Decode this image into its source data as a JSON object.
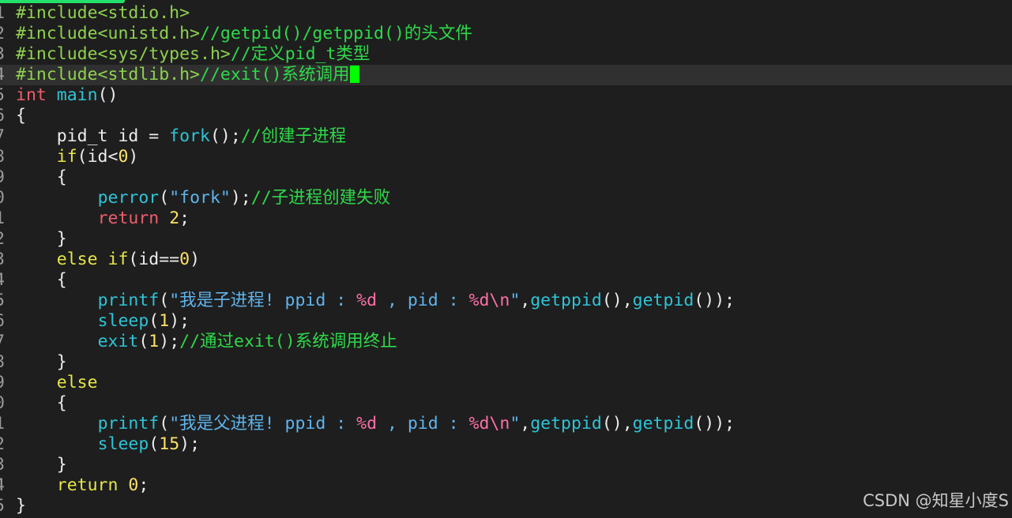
{
  "colors": {
    "preproc": "#8fd14f",
    "comment": "#2fd94a",
    "keyword": "#ee5d6c",
    "keyword2": "#e6e64a",
    "func": "#2ec4d6",
    "number": "#ffe066",
    "string": "#5fb4ec",
    "format": "#ff6fa8",
    "plain": "#ececec"
  },
  "watermark": "CSDN @知星小度S",
  "lines": [
    {
      "n": "1",
      "tokens": [
        {
          "t": "#include<stdio.h>",
          "c": "preproc"
        }
      ]
    },
    {
      "n": "2",
      "tokens": [
        {
          "t": "#include<unistd.h>",
          "c": "preproc"
        },
        {
          "t": "//getpid()/getppid()的头文件",
          "c": "comment"
        }
      ]
    },
    {
      "n": "3",
      "tokens": [
        {
          "t": "#include<sys/types.h>",
          "c": "preproc"
        },
        {
          "t": "//定义pid_t类型",
          "c": "comment"
        }
      ]
    },
    {
      "n": "4",
      "current": true,
      "cursor": true,
      "tokens": [
        {
          "t": "#include<stdlib.h>",
          "c": "preproc"
        },
        {
          "t": "//exit()系统调用",
          "c": "comment"
        }
      ]
    },
    {
      "n": "5",
      "tokens": [
        {
          "t": "int",
          "c": "keyword"
        },
        {
          "t": " ",
          "c": "plain"
        },
        {
          "t": "main",
          "c": "func"
        },
        {
          "t": "()",
          "c": "plain"
        }
      ]
    },
    {
      "n": "6",
      "tokens": [
        {
          "t": "{",
          "c": "plain"
        }
      ]
    },
    {
      "n": "7",
      "tokens": [
        {
          "t": "    pid_t id = ",
          "c": "plain"
        },
        {
          "t": "fork",
          "c": "func"
        },
        {
          "t": "();",
          "c": "plain"
        },
        {
          "t": "//创建子进程",
          "c": "comment"
        }
      ]
    },
    {
      "n": "8",
      "tokens": [
        {
          "t": "    ",
          "c": "plain"
        },
        {
          "t": "if",
          "c": "keyword2"
        },
        {
          "t": "(id<",
          "c": "plain"
        },
        {
          "t": "0",
          "c": "number"
        },
        {
          "t": ")",
          "c": "plain"
        }
      ]
    },
    {
      "n": "9",
      "tokens": [
        {
          "t": "    {",
          "c": "plain"
        }
      ]
    },
    {
      "n": "0",
      "tokens": [
        {
          "t": "        ",
          "c": "plain"
        },
        {
          "t": "perror",
          "c": "func"
        },
        {
          "t": "(",
          "c": "plain"
        },
        {
          "t": "\"fork\"",
          "c": "string"
        },
        {
          "t": ");",
          "c": "plain"
        },
        {
          "t": "//子进程创建失败",
          "c": "comment"
        }
      ]
    },
    {
      "n": "1",
      "tokens": [
        {
          "t": "        ",
          "c": "plain"
        },
        {
          "t": "return",
          "c": "keyword"
        },
        {
          "t": " ",
          "c": "plain"
        },
        {
          "t": "2",
          "c": "number"
        },
        {
          "t": ";",
          "c": "plain"
        }
      ]
    },
    {
      "n": "2",
      "tokens": [
        {
          "t": "    }",
          "c": "plain"
        }
      ]
    },
    {
      "n": "3",
      "tokens": [
        {
          "t": "    ",
          "c": "plain"
        },
        {
          "t": "else if",
          "c": "keyword2"
        },
        {
          "t": "(id==",
          "c": "plain"
        },
        {
          "t": "0",
          "c": "number"
        },
        {
          "t": ")",
          "c": "plain"
        }
      ]
    },
    {
      "n": "4",
      "tokens": [
        {
          "t": "    {",
          "c": "plain"
        }
      ]
    },
    {
      "n": "5",
      "tokens": [
        {
          "t": "        ",
          "c": "plain"
        },
        {
          "t": "printf",
          "c": "func"
        },
        {
          "t": "(",
          "c": "plain"
        },
        {
          "t": "\"我是子进程! ppid : ",
          "c": "string"
        },
        {
          "t": "%d",
          "c": "format"
        },
        {
          "t": " , pid : ",
          "c": "string"
        },
        {
          "t": "%d\\n",
          "c": "format"
        },
        {
          "t": "\"",
          "c": "string"
        },
        {
          "t": ",",
          "c": "plain"
        },
        {
          "t": "getppid",
          "c": "func"
        },
        {
          "t": "(),",
          "c": "plain"
        },
        {
          "t": "getpid",
          "c": "func"
        },
        {
          "t": "());",
          "c": "plain"
        }
      ]
    },
    {
      "n": "6",
      "tokens": [
        {
          "t": "        ",
          "c": "plain"
        },
        {
          "t": "sleep",
          "c": "func"
        },
        {
          "t": "(",
          "c": "plain"
        },
        {
          "t": "1",
          "c": "number"
        },
        {
          "t": ");",
          "c": "plain"
        }
      ]
    },
    {
      "n": "7",
      "tokens": [
        {
          "t": "        ",
          "c": "plain"
        },
        {
          "t": "exit",
          "c": "func"
        },
        {
          "t": "(",
          "c": "plain"
        },
        {
          "t": "1",
          "c": "number"
        },
        {
          "t": ");",
          "c": "plain"
        },
        {
          "t": "//通过exit()系统调用终止",
          "c": "comment"
        }
      ]
    },
    {
      "n": "8",
      "tokens": [
        {
          "t": "    }",
          "c": "plain"
        }
      ]
    },
    {
      "n": "9",
      "tokens": [
        {
          "t": "    ",
          "c": "plain"
        },
        {
          "t": "else",
          "c": "keyword2"
        }
      ]
    },
    {
      "n": "0",
      "tokens": [
        {
          "t": "    {",
          "c": "plain"
        }
      ]
    },
    {
      "n": "1",
      "tokens": [
        {
          "t": "        ",
          "c": "plain"
        },
        {
          "t": "printf",
          "c": "func"
        },
        {
          "t": "(",
          "c": "plain"
        },
        {
          "t": "\"我是父进程! ppid : ",
          "c": "string"
        },
        {
          "t": "%d",
          "c": "format"
        },
        {
          "t": " , pid : ",
          "c": "string"
        },
        {
          "t": "%d\\n",
          "c": "format"
        },
        {
          "t": "\"",
          "c": "string"
        },
        {
          "t": ",",
          "c": "plain"
        },
        {
          "t": "getppid",
          "c": "func"
        },
        {
          "t": "(),",
          "c": "plain"
        },
        {
          "t": "getpid",
          "c": "func"
        },
        {
          "t": "());",
          "c": "plain"
        }
      ]
    },
    {
      "n": "2",
      "tokens": [
        {
          "t": "        ",
          "c": "plain"
        },
        {
          "t": "sleep",
          "c": "func"
        },
        {
          "t": "(",
          "c": "plain"
        },
        {
          "t": "15",
          "c": "number"
        },
        {
          "t": ");",
          "c": "plain"
        }
      ]
    },
    {
      "n": "3",
      "tokens": [
        {
          "t": "    }",
          "c": "plain"
        }
      ]
    },
    {
      "n": "4",
      "tokens": [
        {
          "t": "    ",
          "c": "plain"
        },
        {
          "t": "return",
          "c": "keyword2"
        },
        {
          "t": " ",
          "c": "plain"
        },
        {
          "t": "0",
          "c": "number"
        },
        {
          "t": ";",
          "c": "plain"
        }
      ]
    },
    {
      "n": "5",
      "tokens": [
        {
          "t": "}",
          "c": "plain"
        }
      ]
    }
  ]
}
